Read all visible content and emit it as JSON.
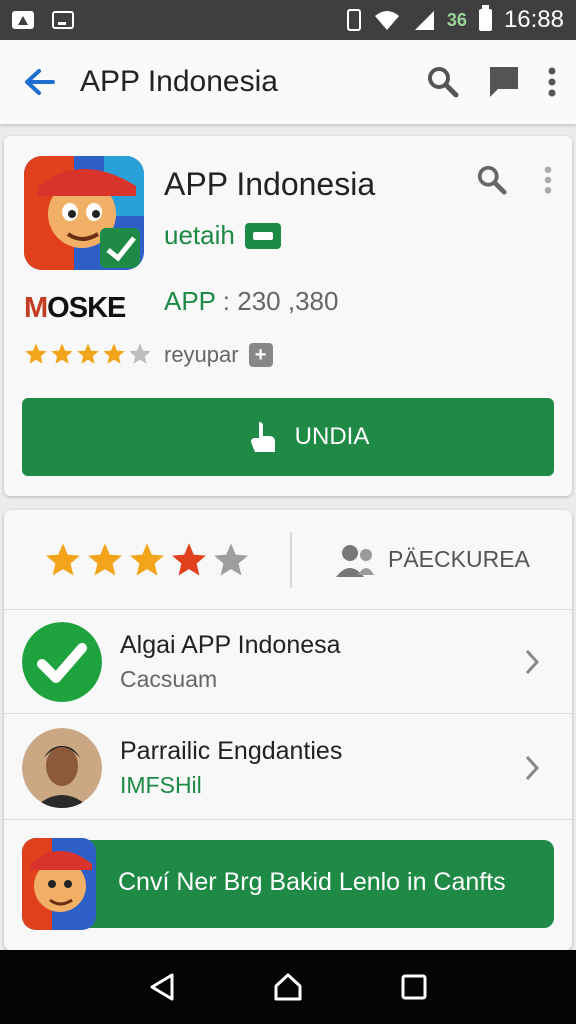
{
  "status_bar": {
    "time": "16:88",
    "network_type": "36",
    "icons": [
      "image-icon",
      "media-icon",
      "phone-icon",
      "wifi-icon",
      "signal-icon",
      "battery-icon"
    ]
  },
  "appbar": {
    "title": "APP Indonesia",
    "icons": [
      "back-arrow-icon",
      "search-icon",
      "chat-icon",
      "more-vert-icon"
    ]
  },
  "app_card": {
    "name": "APP Indonesia",
    "developer": "uetaih",
    "brand_text": "OSKE",
    "brand_initial": "M",
    "count_label": "APP",
    "count_value": ": 230 ,380",
    "category": "reyupar",
    "category_icon": "+",
    "rating_stars": 4,
    "install_label": "UNDIA"
  },
  "ratings": {
    "stars": 4,
    "reviewers_label": "PÄECKUREA"
  },
  "list": [
    {
      "title": "Algai APP Indonesa",
      "subtitle": "Cacsuam"
    },
    {
      "title": "Parrailic Engdanties",
      "subtitle": "IMFSHil"
    }
  ],
  "promo": {
    "text": "Cnví Ner Brg Bakid Lenlo in Canfts"
  },
  "colors": {
    "accent_green": "#1e8a45",
    "status_bar": "#3f3f3f",
    "star_gold": "#f2a51a",
    "star_red": "#e0401c"
  }
}
